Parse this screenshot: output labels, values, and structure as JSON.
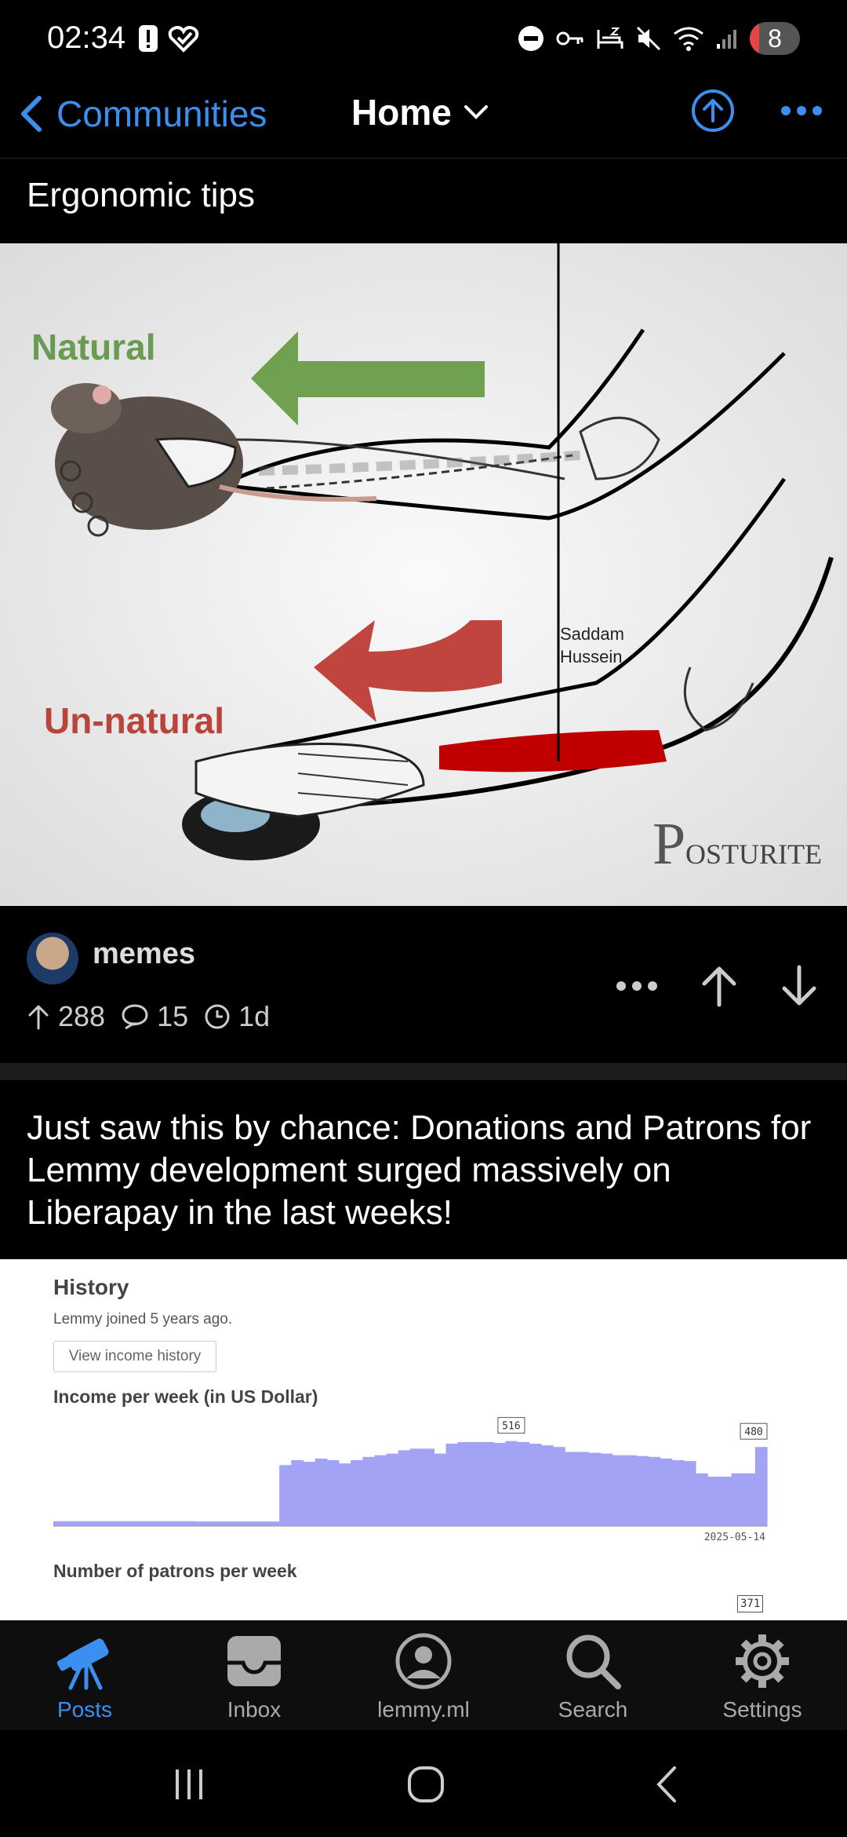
{
  "status": {
    "time": "02:34",
    "battery": "8"
  },
  "nav": {
    "back_label": "Communities",
    "feed_label": "Home"
  },
  "posts": [
    {
      "title": "Ergonomic tips",
      "image": {
        "natural_label": "Natural",
        "unnatural_label": "Un-natural",
        "annotation": "Saddam Hussein",
        "annotation_line1": "Saddam",
        "annotation_line2": "Hussein",
        "brand": "OSTURITE",
        "brand_initial": "P"
      },
      "community": "memes",
      "score": "288",
      "comments": "15",
      "age": "1d"
    },
    {
      "title": "Just saw this by chance: Donations and Patrons for Lemmy development surged massively on Liberapay in the last weeks!",
      "image": {
        "history_title": "History",
        "history_sub": "Lemmy joined 5 years ago.",
        "history_button": "View income history",
        "income_label": "Income per week (in US Dollar)",
        "patrons_label": "Number of patrons per week",
        "peak_tag": "516",
        "last_tag": "480",
        "date_label": "2025-05-14",
        "patrons_tag": "371"
      }
    }
  ],
  "chart_data": {
    "type": "area",
    "title": "Income per week (in US Dollar)",
    "xlabel": "",
    "ylabel": "",
    "x_end_label": "2025-05-14",
    "annotations": [
      {
        "label": "516",
        "x": 38
      },
      {
        "label": "480",
        "x": 59
      }
    ],
    "values": [
      30,
      30,
      30,
      30,
      30,
      30,
      30,
      30,
      30,
      30,
      30,
      30,
      28,
      28,
      28,
      28,
      28,
      28,
      28,
      370,
      400,
      390,
      410,
      400,
      380,
      400,
      420,
      430,
      440,
      460,
      470,
      470,
      440,
      500,
      510,
      510,
      510,
      505,
      516,
      510,
      500,
      490,
      480,
      450,
      450,
      445,
      440,
      430,
      430,
      425,
      420,
      410,
      400,
      395,
      320,
      300,
      300,
      320,
      320,
      480
    ],
    "ylim": [
      0,
      600
    ],
    "color": "#a3a3f5"
  },
  "tabs": [
    {
      "label": "Posts",
      "icon": "telescope-icon"
    },
    {
      "label": "Inbox",
      "icon": "inbox-icon"
    },
    {
      "label": "lemmy.ml",
      "icon": "profile-icon"
    },
    {
      "label": "Search",
      "icon": "search-icon"
    },
    {
      "label": "Settings",
      "icon": "gear-icon"
    }
  ],
  "colors": {
    "accent": "#3b8ff0",
    "battery_low": "#e64545"
  }
}
